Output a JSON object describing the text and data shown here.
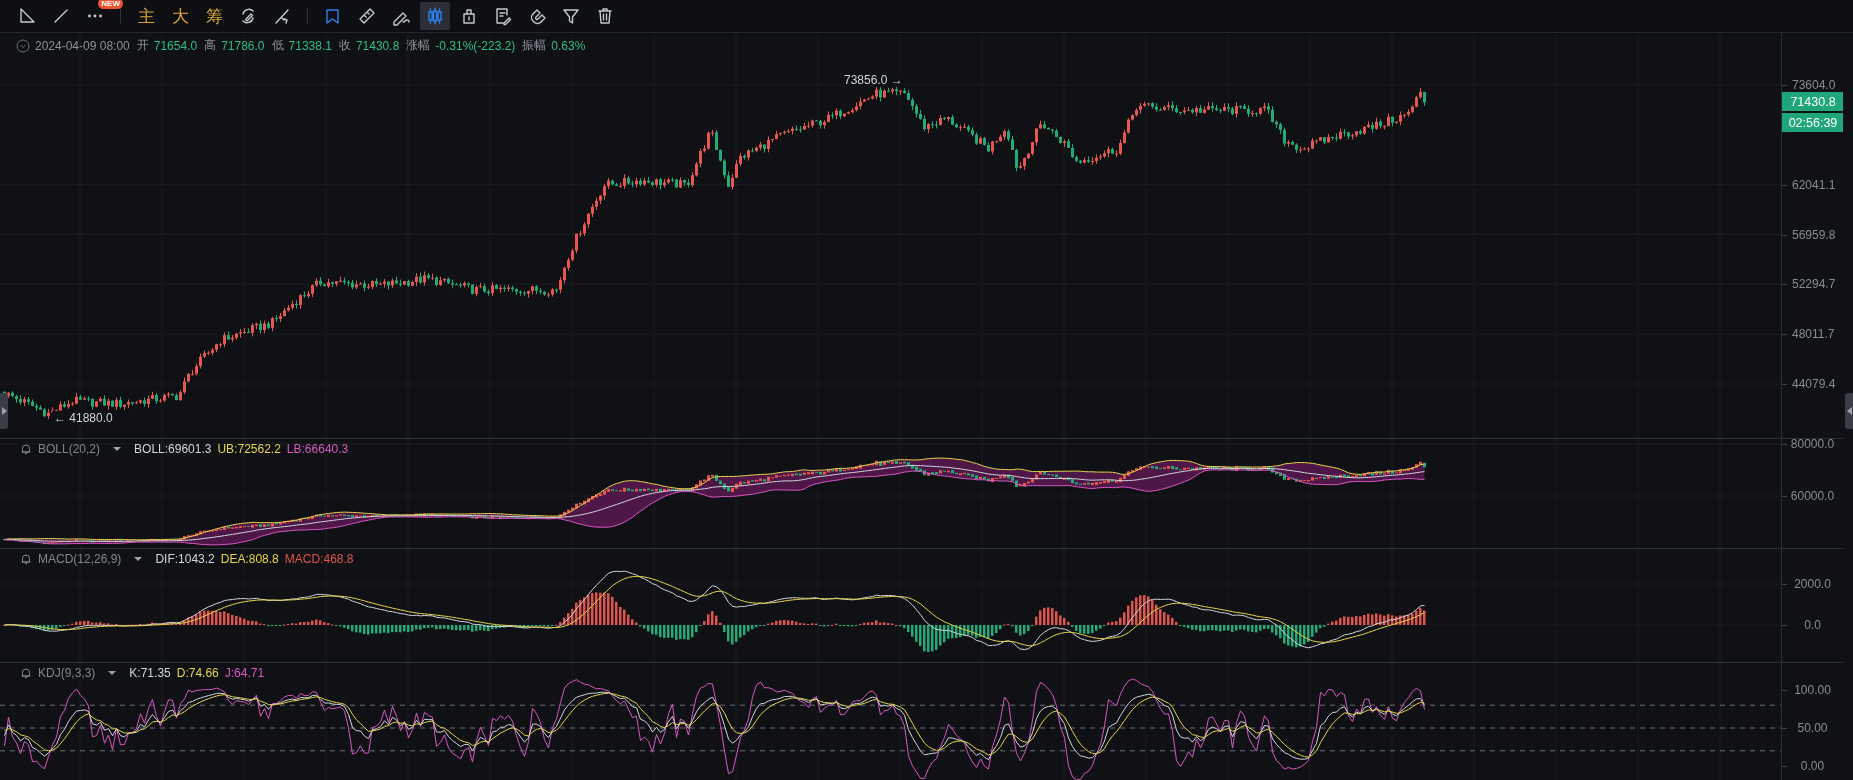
{
  "toolbar": {
    "groups": [
      [
        {
          "kind": "icon",
          "selected": false,
          "active": false
        },
        {
          "kind": "icon",
          "selected": false,
          "active": false
        },
        {
          "kind": "icon",
          "selected": false,
          "active": false,
          "badge": "NEW"
        }
      ],
      [
        {
          "kind": "text",
          "label": "主"
        },
        {
          "kind": "text",
          "label": "大"
        },
        {
          "kind": "text",
          "label": "筹"
        },
        {
          "kind": "icon",
          "selected": false,
          "active": false
        },
        {
          "kind": "icon",
          "selected": false,
          "active": false
        }
      ],
      [
        {
          "kind": "icon",
          "selected": false,
          "active": true
        },
        {
          "kind": "icon",
          "selected": false,
          "active": false
        },
        {
          "kind": "icon",
          "selected": false,
          "active": false
        },
        {
          "kind": "icon",
          "selected": true,
          "active": true
        },
        {
          "kind": "icon",
          "selected": false,
          "active": false
        },
        {
          "kind": "icon",
          "selected": false,
          "active": false
        },
        {
          "kind": "icon",
          "selected": false,
          "active": false
        },
        {
          "kind": "icon",
          "selected": false,
          "active": false
        },
        {
          "kind": "icon",
          "selected": false,
          "active": false
        }
      ]
    ]
  },
  "candle_info": {
    "date": "2024-04-09 08:00",
    "fields": [
      {
        "label": "开",
        "value": "71654.0"
      },
      {
        "label": "高",
        "value": "71786.0"
      },
      {
        "label": "低",
        "value": "71338.1"
      },
      {
        "label": "收",
        "value": "71430.8"
      },
      {
        "label": "涨幅",
        "value": "-0.31%(-223.2)"
      },
      {
        "label": "振幅",
        "value": "0.63%"
      }
    ]
  },
  "price_chart": {
    "high_marker": "73856.0 →",
    "low_marker": "← 41880.0",
    "axis_labels": [
      "73604.0",
      "62041.1",
      "56959.8",
      "52294.7",
      "48011.7",
      "44079.4"
    ],
    "last_price": "71430.8",
    "countdown": "02:56:39"
  },
  "indicators": [
    {
      "kind": "boll",
      "name": "BOLL(20,2)",
      "values": [
        {
          "text": "BOLL:69601.3",
          "color": "#d1d4dc"
        },
        {
          "text": "UB:72562.2",
          "color": "#e6d34a"
        },
        {
          "text": "LB:66640.3",
          "color": "#d957c4"
        }
      ],
      "axis_labels": [
        "80000.0",
        "60000.0"
      ]
    },
    {
      "kind": "macd",
      "name": "MACD(12,26,9)",
      "values": [
        {
          "text": "DIF:1043.2",
          "color": "#d1d4dc"
        },
        {
          "text": "DEA:808.8",
          "color": "#e6d34a"
        },
        {
          "text": "MACD:468.8",
          "color": "#e0544a"
        }
      ],
      "axis_labels": [
        "2000.0",
        "0.0"
      ]
    },
    {
      "kind": "kdj",
      "name": "KDJ(9,3,3)",
      "values": [
        {
          "text": "K:71.35",
          "color": "#d1d4dc"
        },
        {
          "text": "D:74.66",
          "color": "#e6d34a"
        },
        {
          "text": "J:64.71",
          "color": "#d957c4"
        }
      ],
      "axis_labels": [
        "100.00",
        "50.00",
        "0.00"
      ]
    }
  ]
}
